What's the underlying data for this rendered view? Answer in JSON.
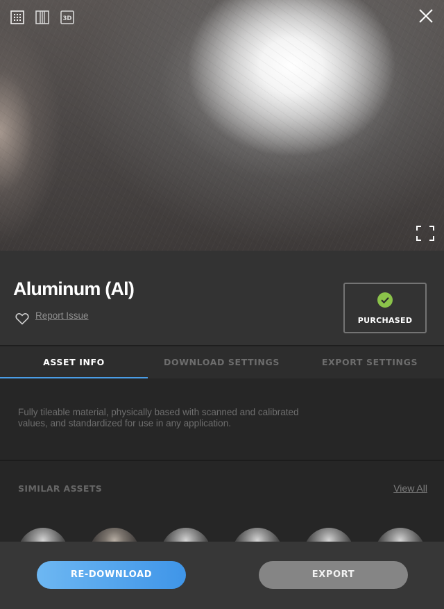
{
  "viewer": {
    "view_modes": [
      {
        "icon": "grid-view-icon"
      },
      {
        "icon": "columns-view-icon"
      },
      {
        "icon": "3d-view-icon",
        "label": "3D"
      }
    ],
    "close_icon": "close-icon",
    "fullscreen_icon": "fullscreen-icon"
  },
  "asset": {
    "title": "Aluminum (Al)",
    "favorite_icon": "heart-icon",
    "report_link": "Report Issue",
    "badge": {
      "icon": "check-circle-icon",
      "label": "PURCHASED",
      "color": "#8bc34a"
    }
  },
  "tabs": [
    {
      "label": "ASSET INFO",
      "active": true
    },
    {
      "label": "DOWNLOAD SETTINGS",
      "active": false
    },
    {
      "label": "EXPORT SETTINGS",
      "active": false
    }
  ],
  "description": "Fully tileable material, physically based with scanned and calibrated values, and standardized for use in any application.",
  "similar": {
    "title": "SIMILAR ASSETS",
    "view_all": "View All",
    "item_count_visible": 6
  },
  "actions": {
    "primary": {
      "label": "RE-DOWNLOAD",
      "color": "#4a9de6"
    },
    "secondary": {
      "label": "EXPORT",
      "color": "#858585"
    }
  },
  "colors": {
    "accent": "#4a9de6",
    "background": "#262626",
    "panel": "#333333"
  }
}
